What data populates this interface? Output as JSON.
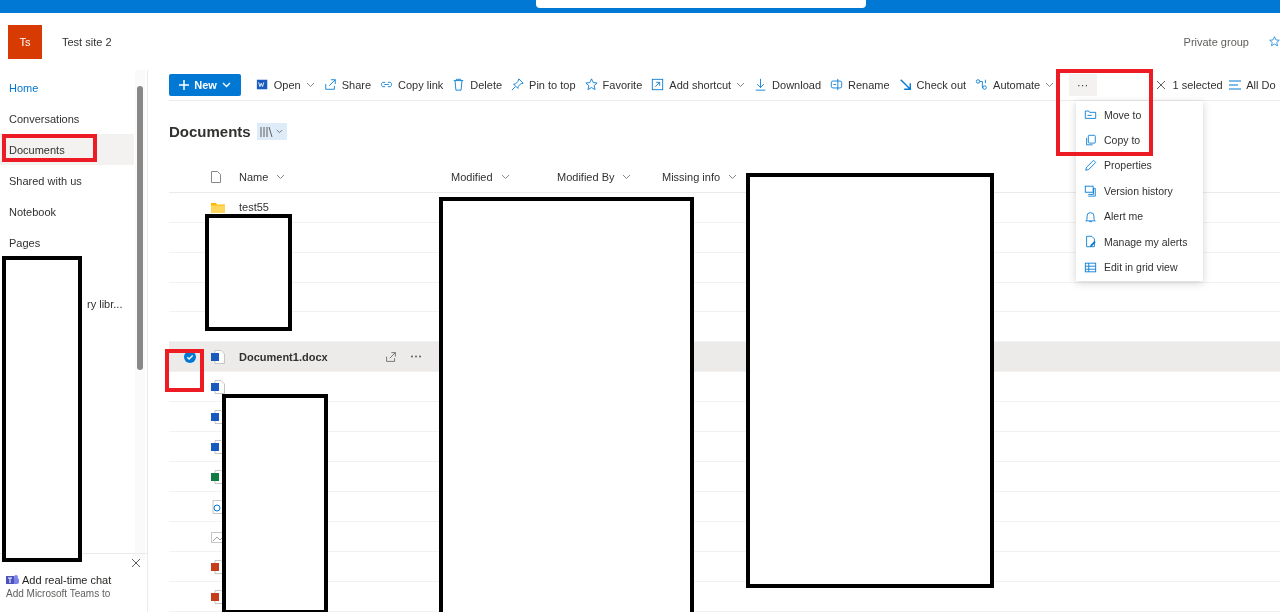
{
  "site": {
    "logo": "Ts",
    "name": "Test site 2",
    "privacy": "Private group"
  },
  "sidebar": {
    "items": [
      {
        "label": "Home",
        "selected": false,
        "link": true
      },
      {
        "label": "Conversations",
        "selected": false,
        "link": false
      },
      {
        "label": "Documents",
        "selected": true,
        "link": false
      },
      {
        "label": "Shared with us",
        "selected": false,
        "link": false
      },
      {
        "label": "Notebook",
        "selected": false,
        "link": false
      },
      {
        "label": "Pages",
        "selected": false,
        "link": false
      },
      {
        "label": "ry libr...",
        "selected": false,
        "link": false
      }
    ],
    "teams_promo": {
      "title": "Add real-time chat",
      "text": "Add Microsoft Teams to"
    }
  },
  "command_bar": {
    "new_button": "New",
    "items": [
      {
        "label": "Open",
        "dropdown": true
      },
      {
        "label": "Share",
        "dropdown": false
      },
      {
        "label": "Copy link",
        "dropdown": false
      },
      {
        "label": "Delete",
        "dropdown": false
      },
      {
        "label": "Pin to top",
        "dropdown": false
      },
      {
        "label": "Favorite",
        "dropdown": false
      },
      {
        "label": "Add shortcut",
        "dropdown": true
      },
      {
        "label": "Download",
        "dropdown": false
      },
      {
        "label": "Rename",
        "dropdown": false
      },
      {
        "label": "Check out",
        "dropdown": false
      },
      {
        "label": "Automate",
        "dropdown": true
      }
    ],
    "more_button": "···",
    "selection": "1 selected",
    "view": "All Do"
  },
  "library": {
    "title": "Documents",
    "columns": [
      "Name",
      "Modified",
      "Modified By",
      "Missing info"
    ],
    "rows": [
      {
        "kind": "folder",
        "name": "test55",
        "selected": false
      },
      {
        "kind": "blank",
        "selected": false
      },
      {
        "kind": "blank",
        "selected": false
      },
      {
        "kind": "blank",
        "selected": false
      },
      {
        "kind": "blank",
        "selected": false
      },
      {
        "kind": "word",
        "name": "Document1.docx",
        "selected": true
      },
      {
        "kind": "word",
        "selected": false
      },
      {
        "kind": "word",
        "selected": false
      },
      {
        "kind": "word",
        "selected": false
      },
      {
        "kind": "excel",
        "selected": false
      },
      {
        "kind": "link",
        "selected": false
      },
      {
        "kind": "image",
        "selected": false
      },
      {
        "kind": "powerpoint",
        "selected": false
      },
      {
        "kind": "powerpoint",
        "selected": false
      }
    ]
  },
  "more_menu": {
    "items": [
      "Move to",
      "Copy to",
      "Properties",
      "Version history",
      "Alert me",
      "Manage my alerts",
      "Edit in grid view"
    ]
  }
}
